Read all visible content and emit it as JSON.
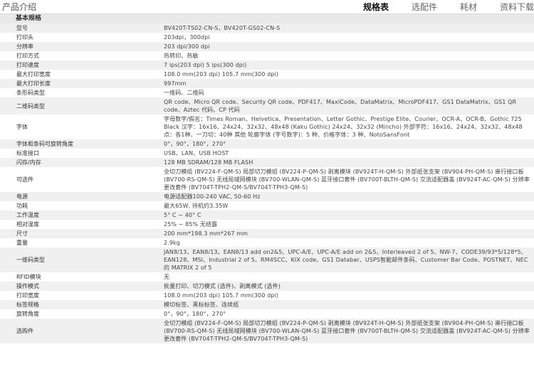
{
  "header": {
    "title": "产品介绍",
    "tabs": [
      {
        "label": "规格表",
        "active": true
      },
      {
        "label": "选配件",
        "active": false
      },
      {
        "label": "耗材",
        "active": false
      },
      {
        "label": "资料下载",
        "active": false
      }
    ]
  },
  "section": {
    "title": "基本规格"
  },
  "rows": [
    {
      "key": "型号",
      "value": "BV420T-TS02-CN-S，BV420T-GS02-CN-S"
    },
    {
      "key": "打印头",
      "value": "203dpi，300dpi"
    },
    {
      "key": "分辨率",
      "value": "203 dpi/300 dpi"
    },
    {
      "key": "打印方式",
      "value": "热转印、热敏"
    },
    {
      "key": "打印速度",
      "value": "7 ips(203 dpi) 5 ips(300 dpi)"
    },
    {
      "key": "最大打印宽度",
      "value": "108.0 mm(203 dpi) 105.7 mm(300 dpi)"
    },
    {
      "key": "最大打印长度",
      "value": "997mm"
    },
    {
      "key": "条形码类型",
      "value": "一维码、二维码"
    },
    {
      "key": "二维码类型",
      "value": "QR code、Micro QR code、Security QR code、PDF417、MaxiCode、DataMatrix、MicroPDF417、GS1 DataMatrix、GS1 QR code、Aztec 代码、CP 代码"
    },
    {
      "key": "字体",
      "value": "字母数字/假名：Times Roman、Helvetica、Presentation、Letter Gothic、Prestige Elite、Courier、OCR-A、OCR-B、Gothic 725 Black 汉字：16x16、24x24、32x32、48x48 (Kaku Gothic) 24x24、32x32 (Mincho) 外部字符：16x16、24x24、32x32、48x48点：各1种、一刀切：40种 其他 轮廓字体 (字号数字)：5 种、价格字体：3 种、NotoSansFont"
    },
    {
      "key": "字体和条码可旋转角度",
      "value": "0°，90°，180°，270°"
    },
    {
      "key": "标准接口",
      "value": "USB、LAN、USB HOST"
    },
    {
      "key": "闪存/内存",
      "value": "128 MB SDRAM/128 MB FLASH"
    },
    {
      "key": "可选件",
      "value": "全切刀模组 (BV224-F-QM-S) 局部切刀模组 (BV224-P-QM-S) 剥离模块 (BV924T-H-QM-S) 外部纸张支架 (BV904-PH-QM-S) 串行接口板 (BV700-RS-QM-S) 无线局域网模块 (BV700-WLAN-QM-S) 蓝牙接口套件 (BV700T-BLTH-QM-S) 交流适配器盖 (BV924T-AC-QM-S) 分辨率更改套件 (BV704T-TPH2-QM-S/BV704T-TPH3-QM-S)"
    },
    {
      "key": "电源",
      "value": "电源适配器100-240 VAC, 50-60 Hz"
    },
    {
      "key": "功耗",
      "value": "最大65W, 待机约3.35W"
    },
    {
      "key": "工作温度",
      "value": "5° C ~ 40° C"
    },
    {
      "key": "相对湿度",
      "value": "25% ~ 85% 无结露"
    },
    {
      "key": "尺寸",
      "value": "200 mm*198.3 mm*267 mm"
    },
    {
      "key": "重量",
      "value": "2.9kg"
    },
    {
      "key": "一维码类型",
      "value": "JAN8/13、EAN8/13、EAN8/13 add on2&5、UPC-A/E、UPC-A/E add on 2&5、Interleaved 2 of 5、NW-7、CODE39/93*5/128*5、EAN128、MSI、Industrial 2 of 5、RM4SCC、KIX code、GS1 Databar、USPS智能邮件条码、Customer Bar Code、POSTNET、NEC 的 MATRIX 2 of 5"
    },
    {
      "key": "RFID模块",
      "value": "无"
    },
    {
      "key": "操作模式",
      "value": "批量打印、切刀模式 (选件)、剥离模式 (选件)"
    },
    {
      "key": "打印宽度",
      "value": "108.0 mm(203 dpi) 105.7 mm(300 dpi)"
    },
    {
      "key": "标签规格",
      "value": "模切标签、黑标标签、连续纸"
    },
    {
      "key": "旋转角度",
      "value": "0°，90°，180°，270°"
    },
    {
      "key": "选购件",
      "value": "全切刀模组 (BV224-F-QM-S) 局部切刀模组 (BV224-P-QM-S) 剥离模块 (BV924T-H-QM-S) 外部纸张支架 (BV904-PH-QM-S) 串行接口板 (BV700-RS-QM-S) 无线局域网模块 (BV700-WLAN-QM-S) 蓝牙接口套件 (BV700T-BLTH-QM-S) 交流适配器盖 (BV924T-AC-QM-S) 分辨率更改套件 (BV704T-TPH2-QM-S/BV704T-TPH3-QM-S)"
    }
  ]
}
